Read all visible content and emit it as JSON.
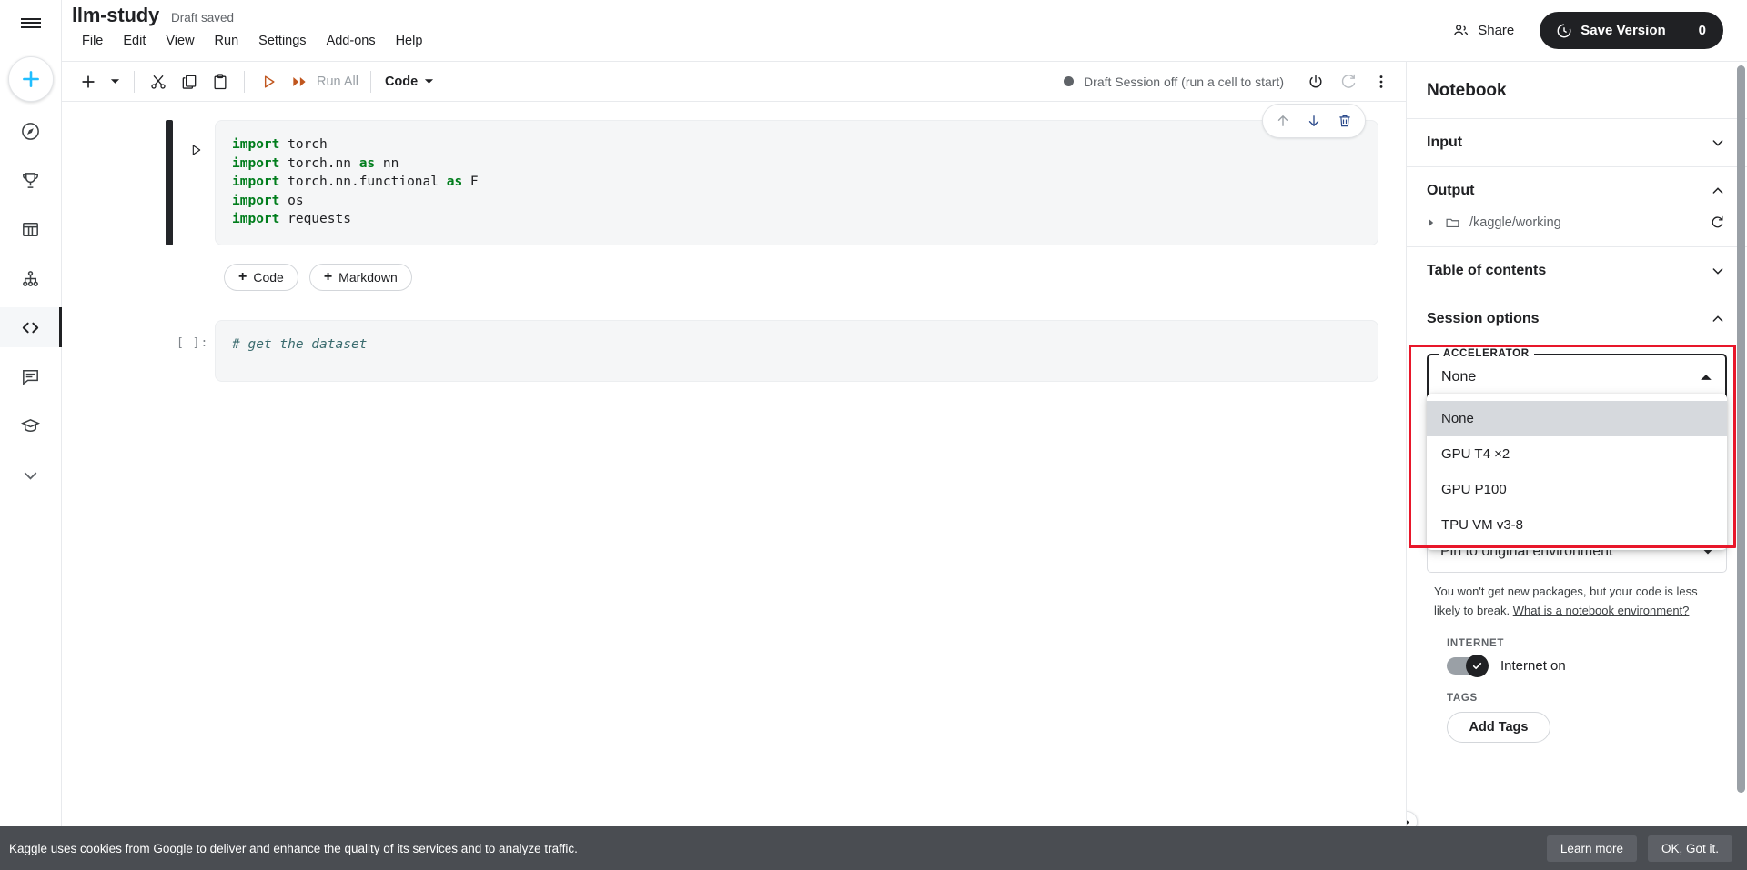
{
  "left_rail": {
    "hamburger": "menu",
    "create_button": "create-new",
    "items": [
      {
        "name": "home-compass-icon",
        "label": "Home"
      },
      {
        "name": "trophy-icon",
        "label": "Competitions"
      },
      {
        "name": "datasets-table-icon",
        "label": "Datasets"
      },
      {
        "name": "models-icon",
        "label": "Models"
      },
      {
        "name": "code-icon",
        "label": "Code",
        "active": true
      },
      {
        "name": "discussions-icon",
        "label": "Discussions"
      },
      {
        "name": "learn-cap-icon",
        "label": "Learn"
      },
      {
        "name": "chevron-down-icon",
        "label": "More"
      }
    ]
  },
  "header": {
    "title": "llm-study",
    "save_status": "Draft saved",
    "menus": [
      "File",
      "Edit",
      "View",
      "Run",
      "Settings",
      "Add-ons",
      "Help"
    ],
    "share_label": "Share",
    "save_version_label": "Save Version",
    "version_count": "0"
  },
  "toolbar": {
    "add_cell": "+",
    "cut_label": "Cut",
    "copy_label": "Copy",
    "paste_label": "Paste",
    "run_label": "Run",
    "run_all_label": "Run All",
    "cell_type": "Code",
    "session_status": "Draft Session off (run a cell to start)",
    "power_label": "Power",
    "restart_label": "Restart",
    "more_label": "More options"
  },
  "notebook": {
    "cells": [
      {
        "type": "code",
        "prompt": "",
        "lines": [
          [
            {
              "t": "import",
              "c": "kw"
            },
            {
              "t": " torch",
              "c": ""
            }
          ],
          [
            {
              "t": "import",
              "c": "kw"
            },
            {
              "t": " torch.nn ",
              "c": ""
            },
            {
              "t": "as",
              "c": "kw"
            },
            {
              "t": " nn",
              "c": ""
            }
          ],
          [
            {
              "t": "import",
              "c": "kw"
            },
            {
              "t": " torch.nn.functional ",
              "c": ""
            },
            {
              "t": "as",
              "c": "kw"
            },
            {
              "t": " F",
              "c": ""
            }
          ],
          [
            {
              "t": "import",
              "c": "kw"
            },
            {
              "t": " os",
              "c": ""
            }
          ],
          [
            {
              "t": "import",
              "c": "kw"
            },
            {
              "t": " requests",
              "c": ""
            }
          ]
        ]
      },
      {
        "type": "code",
        "prompt": "[ ]:",
        "lines": [
          [
            {
              "t": "# get the dataset",
              "c": "cmt"
            }
          ]
        ]
      }
    ],
    "add_code_label": "Code",
    "add_markdown_label": "Markdown",
    "cell_actions": {
      "move_up": "Move up",
      "move_down": "Move down",
      "delete": "Delete cell"
    }
  },
  "sidebar": {
    "title": "Notebook",
    "input": {
      "label": "Input",
      "expanded": false
    },
    "output": {
      "label": "Output",
      "expanded": true,
      "path": "/kaggle/working",
      "refresh_label": "Refresh"
    },
    "toc": {
      "label": "Table of contents",
      "expanded": false
    },
    "session_options": {
      "label": "Session options",
      "expanded": true,
      "accelerator": {
        "legend": "ACCELERATOR",
        "value": "None",
        "open": true,
        "options": [
          "None",
          "GPU T4 ×2",
          "GPU P100",
          "TPU VM v3-8"
        ],
        "selected_index": 0,
        "highlight_color": "#e8172a"
      },
      "environment": {
        "value": "Pin to original environment",
        "help_text": "You won't get new packages, but your code is less likely to break.",
        "help_link": "What is a notebook environment?"
      },
      "internet": {
        "label": "INTERNET",
        "state_label": "Internet on",
        "on": true
      },
      "tags": {
        "label": "TAGS",
        "add_button": "Add Tags"
      }
    }
  },
  "cookie_banner": {
    "text": "Kaggle uses cookies from Google to deliver and enhance the quality of its services and to analyze traffic.",
    "learn_more": "Learn more",
    "accept": "OK, Got it."
  }
}
